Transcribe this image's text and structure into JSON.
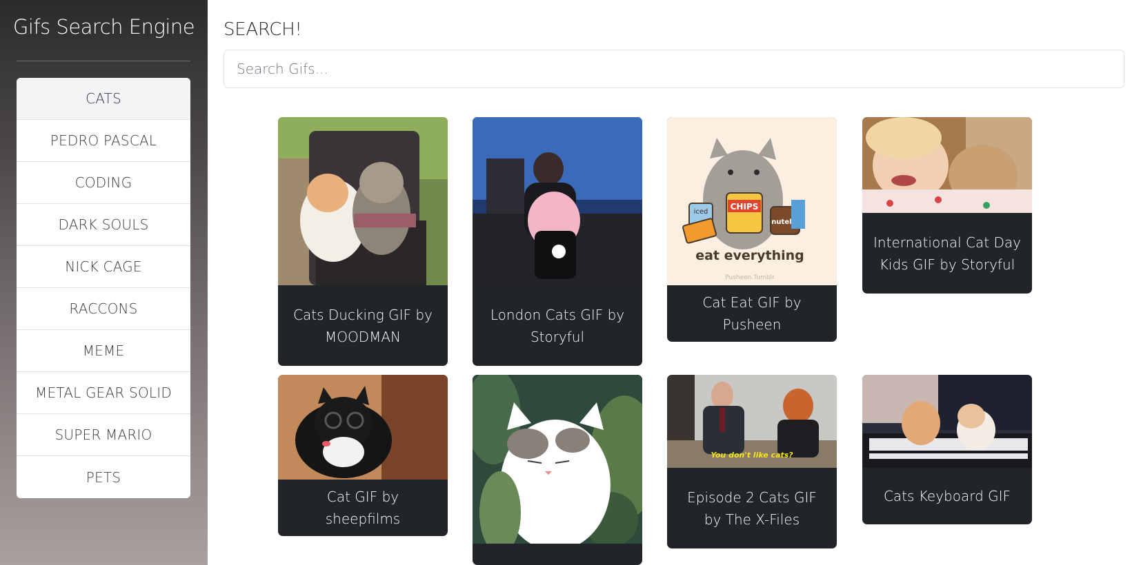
{
  "sidebar": {
    "brand": "Gifs Search Engine",
    "items": [
      {
        "label": "CATS",
        "active": true
      },
      {
        "label": "PEDRO PASCAL"
      },
      {
        "label": "CODING"
      },
      {
        "label": "DARK SOULS"
      },
      {
        "label": "NICK CAGE"
      },
      {
        "label": "RACCONS"
      },
      {
        "label": "MEME"
      },
      {
        "label": "METAL GEAR SOLID"
      },
      {
        "label": "SUPER MARIO"
      },
      {
        "label": "PETS"
      }
    ]
  },
  "search": {
    "title": "SEARCH!",
    "placeholder": "Search Gifs...",
    "value": ""
  },
  "gifs": [
    {
      "caption": "Cats Ducking GIF by MOODMAN"
    },
    {
      "caption": "London Cats GIF by Storyful"
    },
    {
      "caption": "Cat Eat GIF by Pusheen",
      "image_text": {
        "line1": "eat everything",
        "chips": "CHIPS",
        "nutella": "nutella",
        "iced": "iced",
        "cheez": "CHEEZ CURLZ",
        "source": "Pusheen.Tumblr"
      }
    },
    {
      "caption": "International Cat Day Kids GIF by Storyful"
    },
    {
      "caption": "Cat GIF by sheepfilms"
    },
    {
      "caption": ""
    },
    {
      "caption": "Episode 2 Cats GIF by The X-Files",
      "image_text": {
        "subtitle": "You don't like cats?"
      }
    },
    {
      "caption": "Cats Keyboard GIF"
    }
  ],
  "colors": {
    "card_bg": "#212529",
    "sidebar_top": "#2b2b2b",
    "sidebar_bottom": "#a9a0a0"
  }
}
